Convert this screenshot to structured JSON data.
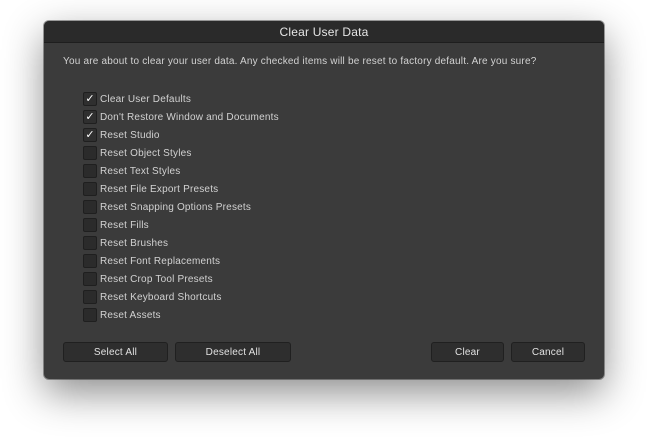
{
  "dialog": {
    "title": "Clear User Data",
    "message": "You are about to clear your user data. Any checked items will be reset to factory default. Are you sure?"
  },
  "items": [
    {
      "label": "Clear User Defaults",
      "checked": true
    },
    {
      "label": "Don't Restore Window and Documents",
      "checked": true
    },
    {
      "label": "Reset Studio",
      "checked": true
    },
    {
      "label": "Reset Object Styles",
      "checked": false
    },
    {
      "label": "Reset Text Styles",
      "checked": false
    },
    {
      "label": "Reset File Export Presets",
      "checked": false
    },
    {
      "label": "Reset Snapping Options Presets",
      "checked": false
    },
    {
      "label": "Reset Fills",
      "checked": false
    },
    {
      "label": "Reset Brushes",
      "checked": false
    },
    {
      "label": "Reset Font Replacements",
      "checked": false
    },
    {
      "label": "Reset Crop Tool Presets",
      "checked": false
    },
    {
      "label": "Reset Keyboard Shortcuts",
      "checked": false
    },
    {
      "label": "Reset Assets",
      "checked": false
    }
  ],
  "buttons": {
    "select_all": "Select All",
    "deselect_all": "Deselect All",
    "clear": "Clear",
    "cancel": "Cancel"
  },
  "checkmark_glyph": "✓"
}
